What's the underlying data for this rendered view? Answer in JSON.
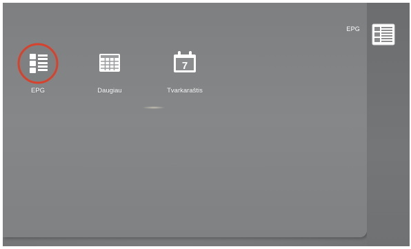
{
  "header": {
    "breadcrumb": "EPG"
  },
  "sidebar": {
    "icon": "epg-list-icon"
  },
  "menu": {
    "items": [
      {
        "label": "EPG",
        "icon": "epg-list-icon",
        "selected": true
      },
      {
        "label": "Daugiau",
        "icon": "grid-table-icon",
        "selected": false
      },
      {
        "label": "Tvarkaraštis",
        "icon": "calendar-icon",
        "selected": false,
        "calendar_day": "7"
      }
    ]
  },
  "colors": {
    "selection_ring": "#d8422c",
    "icon_fill": "#ffffff"
  }
}
